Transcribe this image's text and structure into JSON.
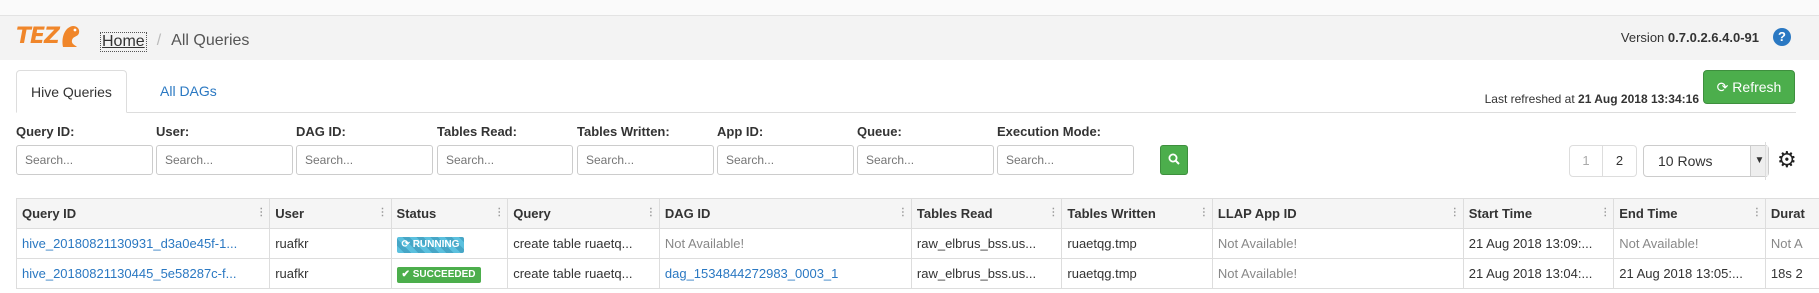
{
  "app": {
    "logo_text": "TEZ",
    "breadcrumb": {
      "home": "Home",
      "current": "All Queries"
    },
    "version_label": "Version",
    "version_value": "0.7.0.2.6.4.0-91",
    "help_icon": "?"
  },
  "tabs": [
    {
      "label": "Hive Queries"
    },
    {
      "label": "All DAGs"
    }
  ],
  "refresh": {
    "last_refreshed_label": "Last refreshed at",
    "last_refreshed_value": "21 Aug 2018 13:34:16",
    "button_label": "Refresh",
    "icon": "⟳"
  },
  "filters": {
    "placeholder": "Search...",
    "labels": {
      "query_id": "Query ID:",
      "user": "User:",
      "dag_id": "DAG ID:",
      "tables_read": "Tables Read:",
      "tables_written": "Tables Written:",
      "app_id": "App ID:",
      "queue": "Queue:",
      "execution_mode": "Execution Mode:"
    },
    "search_icon": "search-icon"
  },
  "pagination": {
    "page1": "1",
    "page2": "2",
    "rows": "10 Rows"
  },
  "table": {
    "headers": [
      "Query ID",
      "User",
      "Status",
      "Query",
      "DAG ID",
      "Tables Read",
      "Tables Written",
      "LLAP App ID",
      "Start Time",
      "End Time",
      "Durat"
    ],
    "rows": [
      {
        "query_id": "hive_20180821130931_d3a0e45f-1...",
        "user": "ruafkr",
        "status": "RUNNING",
        "query": "create table ruaetq...",
        "dag_id": "Not Available!",
        "tables_read": "raw_elbrus_bss.us...",
        "tables_written": "ruaetqg.tmp",
        "llap_app_id": "Not Available!",
        "start_time": "21 Aug 2018 13:09:...",
        "end_time": "Not Available!",
        "duration": "Not A"
      },
      {
        "query_id": "hive_20180821130445_5e58287c-f...",
        "user": "ruafkr",
        "status": "SUCCEEDED",
        "query": "create table ruaetq...",
        "dag_id": "dag_1534844272983_0003_1",
        "tables_read": "raw_elbrus_bss.us...",
        "tables_written": "ruaetqg.tmp",
        "llap_app_id": "Not Available!",
        "start_time": "21 Aug 2018 13:04:...",
        "end_time": "21 Aug 2018 13:05:...",
        "duration": "18s 2"
      }
    ]
  }
}
